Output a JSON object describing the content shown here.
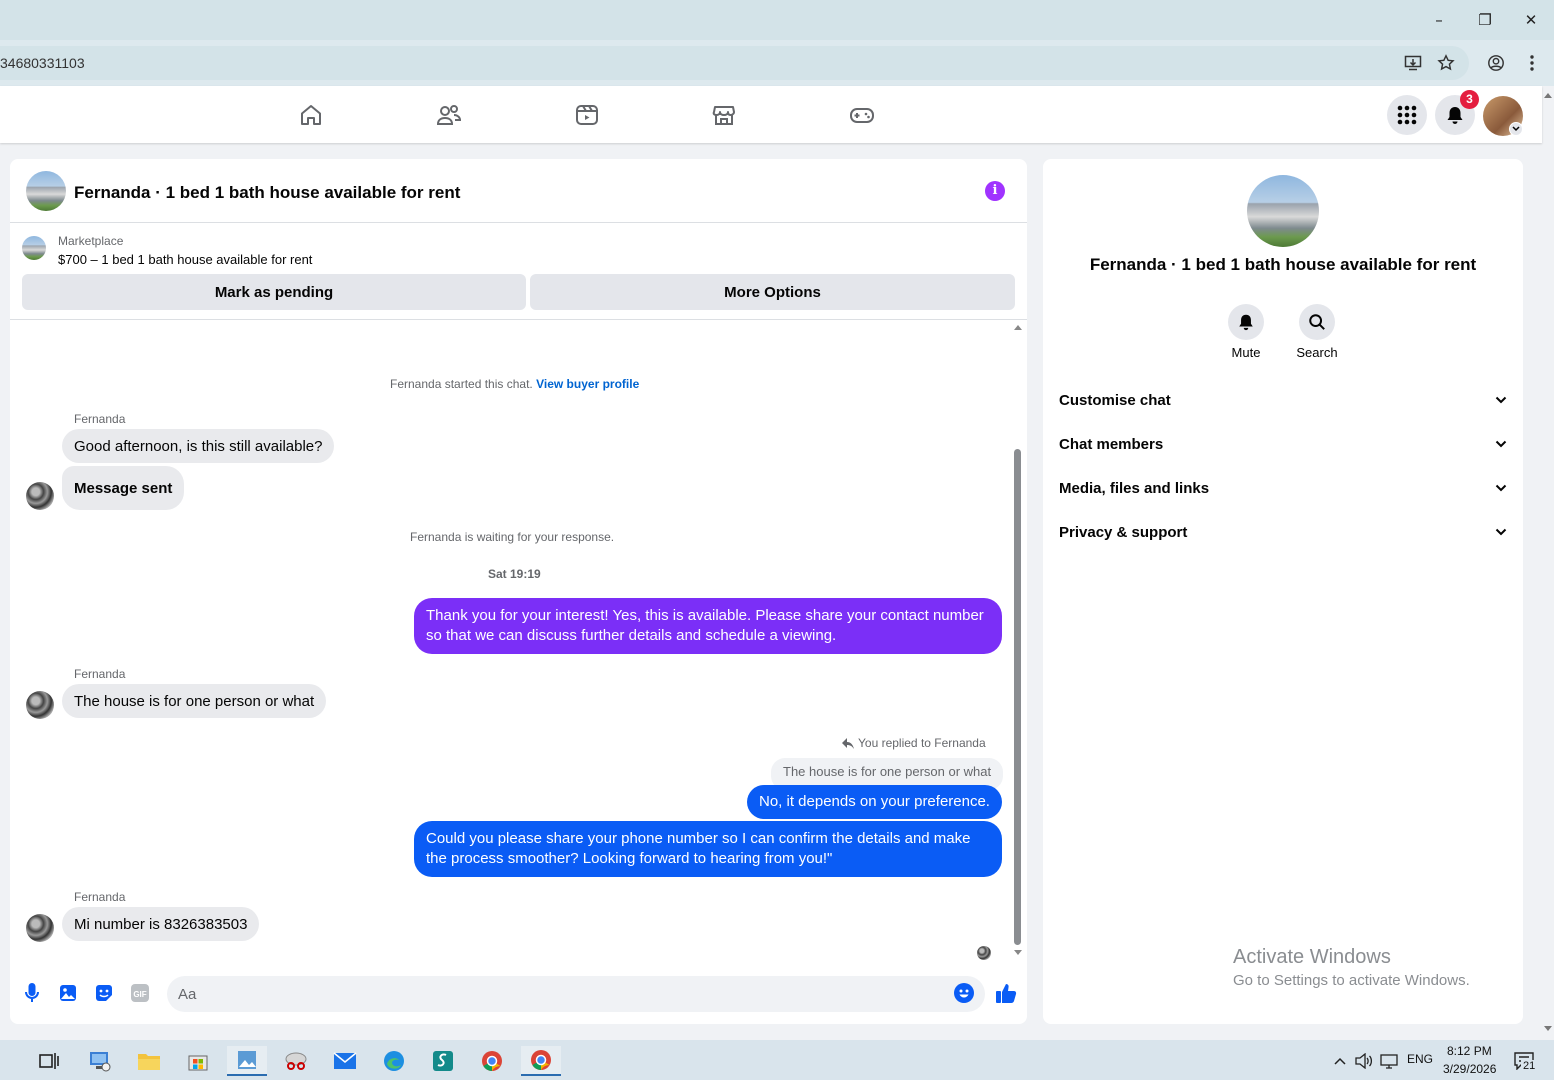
{
  "browser": {
    "url_fragment": "34680331103",
    "window_controls": {
      "minimize": "–",
      "restore": "❐",
      "close": "✕"
    }
  },
  "facebook_nav": {
    "tabs": [
      "home",
      "friends",
      "video",
      "marketplace",
      "gaming"
    ],
    "notification_count": "3"
  },
  "chat": {
    "header_title": "Fernanda · 1 bed 1 bath house available for rent",
    "marketplace": {
      "label": "Marketplace",
      "listing": "$700 – 1 bed 1 bath house available for rent",
      "mark_pending": "Mark as pending",
      "more_options": "More Options"
    },
    "started_text": "Fernanda started this chat.",
    "view_buyer_profile": "View buyer profile",
    "waiting_text": "Fernanda is waiting for your response.",
    "timestamp": "Sat 19:19",
    "messages": {
      "m1_sender": "Fernanda",
      "m1_text": "Good afternoon, is this still available?",
      "m1_sent": "Message sent",
      "m2_text": "Thank you for your interest! Yes, this is available. Please share your contact number so that we can discuss further details and schedule a viewing.",
      "m3_sender": "Fernanda",
      "m3_text": "The house is for one person or what",
      "reply_label": "You replied to Fernanda",
      "reply_quote": "The house is for one person or what",
      "m4_text": "No, it depends on your preference.",
      "m5_text": "Could you please share your phone number so I can confirm the details and make the process smoother? Looking forward to hearing from you!\"",
      "m6_sender": "Fernanda",
      "m6_text": "Mi number is 8326383503"
    },
    "composer_placeholder": "Aa"
  },
  "side_panel": {
    "name": "Fernanda · 1 bed 1 bath house available for rent",
    "mute_label": "Mute",
    "search_label": "Search",
    "sections": [
      "Customise chat",
      "Chat members",
      "Media, files and links",
      "Privacy & support"
    ]
  },
  "watermark": {
    "line1": "Activate Windows",
    "line2": "Go to Settings to activate Windows."
  },
  "taskbar": {
    "lang": "ENG",
    "time": "8:12 PM",
    "date": "3/29/2026",
    "notif_count": "21"
  },
  "colors": {
    "accent_purple": "#7b2ff7",
    "accent_blue": "#0a5cf5",
    "info_purple": "#a033ff",
    "link_blue": "#0064d1"
  }
}
